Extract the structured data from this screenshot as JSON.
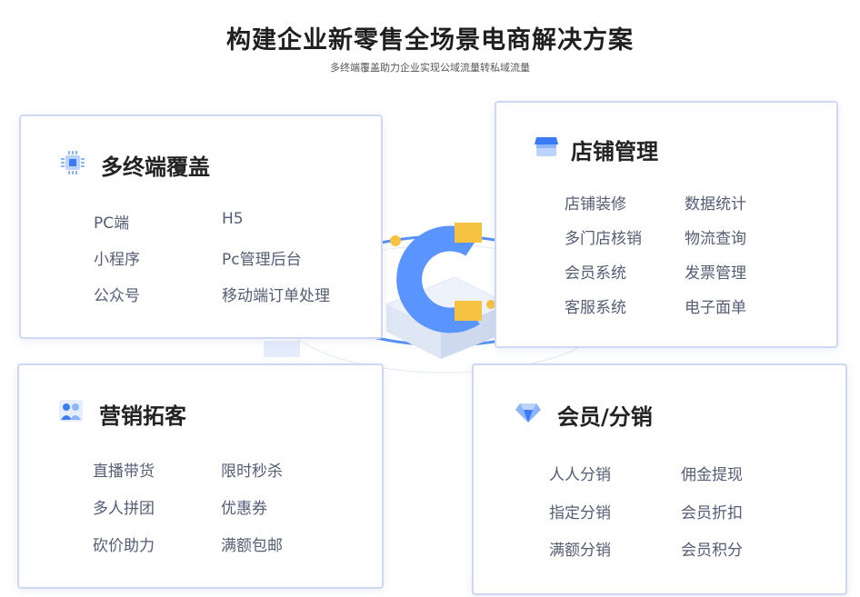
{
  "header": {
    "title": "构建企业新零售全场景电商解决方案",
    "subtitle": "多终端覆盖助力企业实现公域流量转私域流量"
  },
  "cards": {
    "terminals": {
      "title": "多终端覆盖",
      "icon": "chip-icon",
      "items": [
        "PC端",
        "H5",
        "小程序",
        "Pc管理后台",
        "公众号",
        "移动端订单处理"
      ]
    },
    "store": {
      "title": "店铺管理",
      "icon": "storefront-icon",
      "items": [
        "店铺装修",
        "数据统计",
        "多门店核销",
        "物流查询",
        "会员系统",
        "发票管理",
        "客服系统",
        "电子面单"
      ]
    },
    "marketing": {
      "title": "营销拓客",
      "icon": "users-icon",
      "items": [
        "直播带货",
        "限时秒杀",
        "多人拼团",
        "优惠券",
        "砍价助力",
        "满额包邮"
      ]
    },
    "member": {
      "title": "会员/分销",
      "icon": "diamond-icon",
      "items": [
        "人人分销",
        "佣金提现",
        "指定分销",
        "会员折扣",
        "满额分销",
        "会员积分"
      ]
    }
  },
  "colors": {
    "accent": "#3b7cf6",
    "accent_light": "#8db4ff",
    "card_border": "#cfd8f3",
    "feature_text": "#555d75",
    "gold": "#f5c242"
  }
}
